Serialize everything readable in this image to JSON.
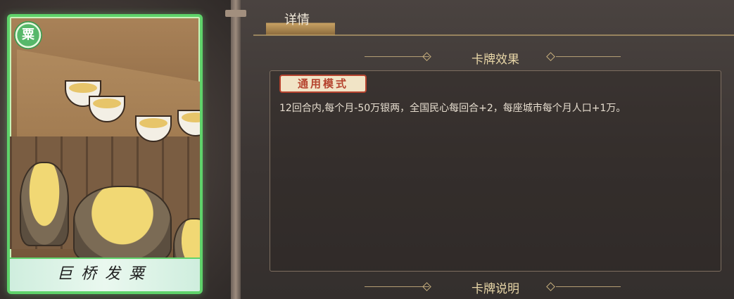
{
  "card": {
    "name": "巨桥发粟",
    "emblem_char": "粟",
    "border_color": "#5fd36a"
  },
  "tabs": [
    {
      "label": "详情",
      "active": true
    }
  ],
  "sections": {
    "effect_title": "卡牌效果",
    "description_title": "卡牌说明"
  },
  "effect": {
    "mode_badge": "通用模式",
    "text": "12回合内,每个月-50万银两，全国民心每回合+2，每座城市每个月人口+1万。"
  },
  "colors": {
    "accent_gold": "#c9a264",
    "badge_red": "#b5432e"
  }
}
